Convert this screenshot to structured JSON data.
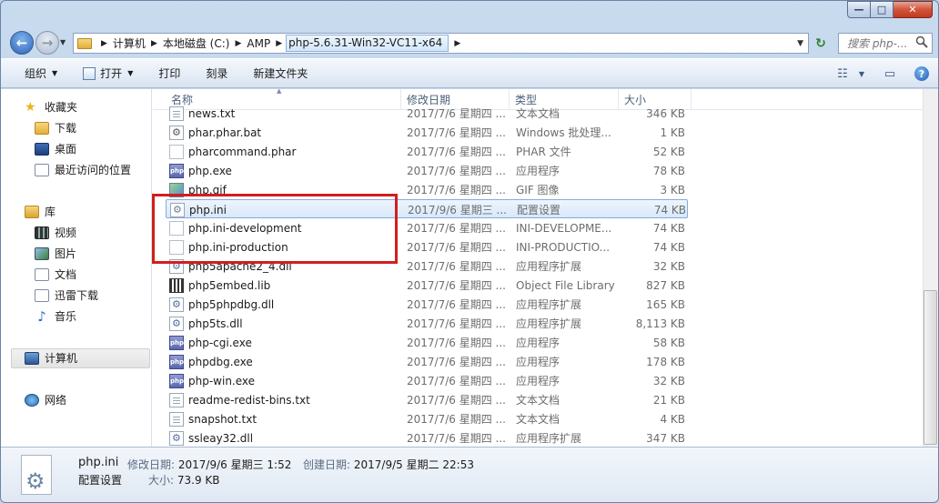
{
  "titlebar": {
    "min_glyph": "—",
    "max_glyph": "□",
    "close_glyph": "✕"
  },
  "nav": {
    "back_glyph": "←",
    "forward_glyph": "→"
  },
  "address": {
    "crumbs": [
      "计算机",
      "本地磁盘 (C:)",
      "AMP",
      "php-5.6.31-Win32-VC11-x64"
    ],
    "refresh_glyph": "↻"
  },
  "search": {
    "placeholder": "搜索 php-..."
  },
  "toolbar": {
    "organize": "组织",
    "open": "打开",
    "print": "打印",
    "burn": "刻录",
    "new_folder": "新建文件夹"
  },
  "sidebar": {
    "favorites": {
      "label": "收藏夹",
      "items": [
        "下载",
        "桌面",
        "最近访问的位置"
      ]
    },
    "libraries": {
      "label": "库",
      "items": [
        "视频",
        "图片",
        "文档",
        "迅雷下载",
        "音乐"
      ]
    },
    "computer": {
      "label": "计算机"
    },
    "network": {
      "label": "网络"
    }
  },
  "columns": {
    "name": "名称",
    "date": "修改日期",
    "type": "类型",
    "size": "大小"
  },
  "files": [
    {
      "name": "news.txt",
      "date": "2017/7/6 星期四 ...",
      "type": "文本文档",
      "size": "346 KB",
      "icon": "txt"
    },
    {
      "name": "phar.phar.bat",
      "date": "2017/7/6 星期四 ...",
      "type": "Windows 批处理...",
      "size": "1 KB",
      "icon": "bat"
    },
    {
      "name": "pharcommand.phar",
      "date": "2017/7/6 星期四 ...",
      "type": "PHAR 文件",
      "size": "52 KB",
      "icon": "blank"
    },
    {
      "name": "php.exe",
      "date": "2017/7/6 星期四 ...",
      "type": "应用程序",
      "size": "78 KB",
      "icon": "php"
    },
    {
      "name": "php.gif",
      "date": "2017/7/6 星期四 ...",
      "type": "GIF 图像",
      "size": "3 KB",
      "icon": "gif"
    },
    {
      "name": "php.ini",
      "date": "2017/9/6 星期三 ...",
      "type": "配置设置",
      "size": "74 KB",
      "icon": "ini",
      "selected": true
    },
    {
      "name": "php.ini-development",
      "date": "2017/7/6 星期四 ...",
      "type": "INI-DEVELOPME...",
      "size": "74 KB",
      "icon": "blank"
    },
    {
      "name": "php.ini-production",
      "date": "2017/7/6 星期四 ...",
      "type": "INI-PRODUCTIO...",
      "size": "74 KB",
      "icon": "blank"
    },
    {
      "name": "php5apache2_4.dll",
      "date": "2017/7/6 星期四 ...",
      "type": "应用程序扩展",
      "size": "32 KB",
      "icon": "dll"
    },
    {
      "name": "php5embed.lib",
      "date": "2017/7/6 星期四 ...",
      "type": "Object File Library",
      "size": "827 KB",
      "icon": "lib"
    },
    {
      "name": "php5phpdbg.dll",
      "date": "2017/7/6 星期四 ...",
      "type": "应用程序扩展",
      "size": "165 KB",
      "icon": "dll"
    },
    {
      "name": "php5ts.dll",
      "date": "2017/7/6 星期四 ...",
      "type": "应用程序扩展",
      "size": "8,113 KB",
      "icon": "dll"
    },
    {
      "name": "php-cgi.exe",
      "date": "2017/7/6 星期四 ...",
      "type": "应用程序",
      "size": "58 KB",
      "icon": "php"
    },
    {
      "name": "phpdbg.exe",
      "date": "2017/7/6 星期四 ...",
      "type": "应用程序",
      "size": "178 KB",
      "icon": "php"
    },
    {
      "name": "php-win.exe",
      "date": "2017/7/6 星期四 ...",
      "type": "应用程序",
      "size": "32 KB",
      "icon": "php"
    },
    {
      "name": "readme-redist-bins.txt",
      "date": "2017/7/6 星期四 ...",
      "type": "文本文档",
      "size": "21 KB",
      "icon": "txt"
    },
    {
      "name": "snapshot.txt",
      "date": "2017/7/6 星期四 ...",
      "type": "文本文档",
      "size": "4 KB",
      "icon": "txt"
    },
    {
      "name": "ssleay32.dll",
      "date": "2017/7/6 星期四 ...",
      "type": "应用程序扩展",
      "size": "347 KB",
      "icon": "dll"
    }
  ],
  "details": {
    "name": "php.ini",
    "type": "配置设置",
    "modified_label": "修改日期:",
    "modified": "2017/9/6 星期三 1:52",
    "created_label": "创建日期:",
    "created": "2017/9/5 星期二 22:53",
    "size_label": "大小:",
    "size": "73.9 KB"
  },
  "colors": {
    "highlight_box": "#d21e1e",
    "selection": "#d8e8f9"
  }
}
